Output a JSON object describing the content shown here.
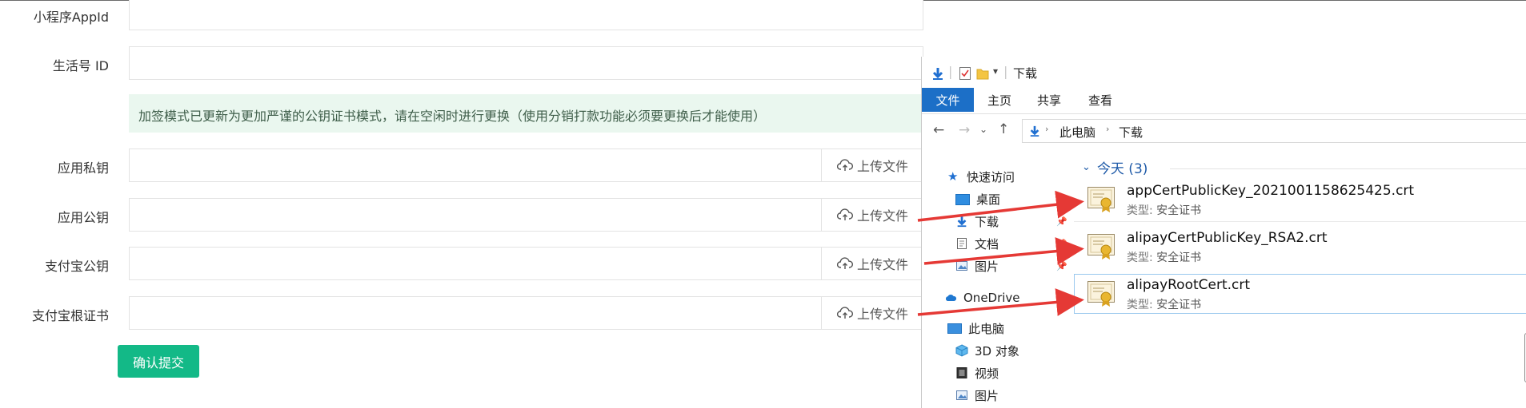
{
  "form": {
    "labels": {
      "appid": "小程序AppId",
      "life_id": "生活号 ID",
      "app_private_key": "应用私钥",
      "app_public_key": "应用公钥",
      "alipay_public_key": "支付宝公钥",
      "alipay_root_cert": "支付宝根证书"
    },
    "notice": "加签模式已更新为更加严谨的公钥证书模式，请在空闲时进行更换（使用分销打款功能必须要更换后才能使用）",
    "upload_label": "上传文件",
    "submit_label": "确认提交"
  },
  "explorer": {
    "title": "下载",
    "ribbon_tabs": [
      "文件",
      "主页",
      "共享",
      "查看"
    ],
    "breadcrumb": [
      "此电脑",
      "下载"
    ],
    "nav": {
      "quick_access": "快速访问",
      "desktop": "桌面",
      "downloads": "下载",
      "documents": "文档",
      "pictures": "图片",
      "onedrive": "OneDrive",
      "this_pc": "此电脑",
      "objects3d": "3D 对象",
      "videos": "视频",
      "pictures2": "图片"
    },
    "group_header": "今天 (3)",
    "type_label": "类型:",
    "files": [
      {
        "name": "appCertPublicKey_2021001158625425.crt",
        "type": "安全证书"
      },
      {
        "name": "alipayCertPublicKey_RSA2.crt",
        "type": "安全证书"
      },
      {
        "name": "alipayRootCert.crt",
        "type": "安全证书"
      }
    ]
  },
  "colors": {
    "accent_green": "#13b987",
    "ribbon_blue": "#1c6fc7",
    "arrow_red": "#e53935"
  }
}
